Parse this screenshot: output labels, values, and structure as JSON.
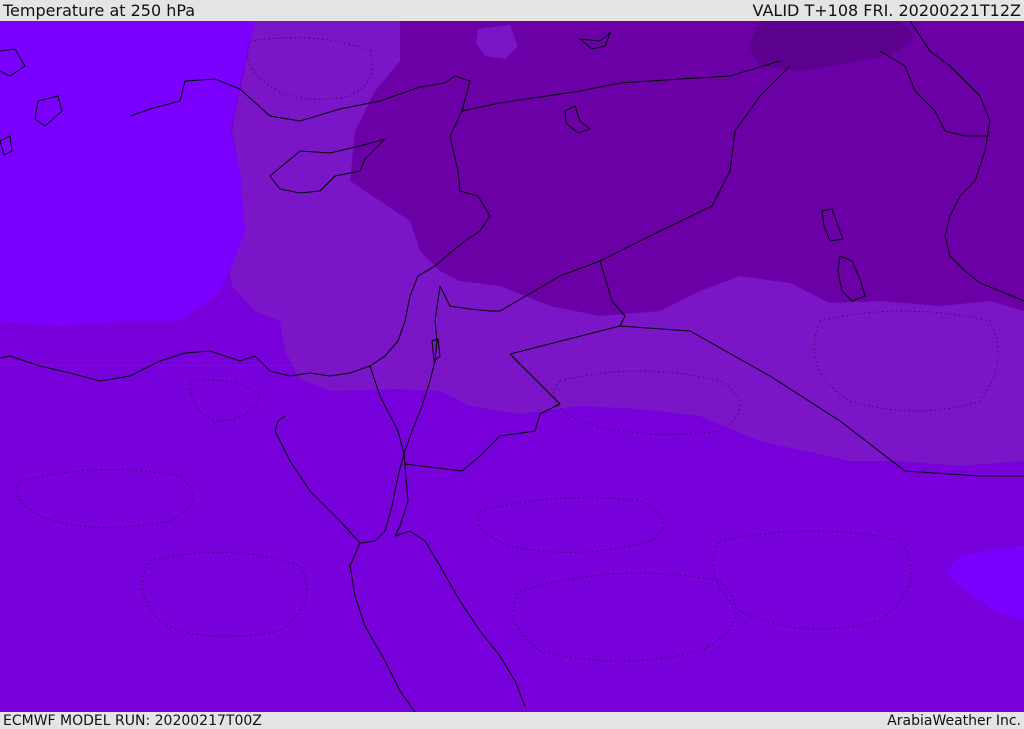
{
  "header": {
    "title": "Temperature at 250 hPa",
    "valid": "VALID T+108 FRI. 20200221T12Z"
  },
  "footer": {
    "model_run": "ECMWF MODEL RUN: 20200217T00Z",
    "credit": "ArabiaWeather Inc."
  },
  "colors": {
    "base": "#7700db",
    "cold_band": "#7b16c8",
    "colder_band": "#6a00a6",
    "coldest_band": "#5c008e",
    "warm_band": "#7c00ff",
    "coastline": "#000000"
  }
}
